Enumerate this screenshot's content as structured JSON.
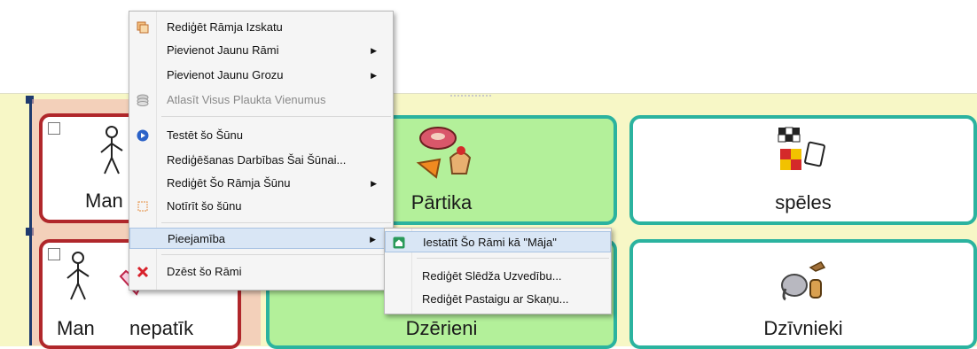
{
  "context_menu": {
    "items": [
      {
        "label": "Rediģēt Rāmja Izskatu",
        "icon": "frame-appearance-icon",
        "disabled": false,
        "submenu": false
      },
      {
        "label": "Pievienot Jaunu Rāmi",
        "icon": "",
        "disabled": false,
        "submenu": true
      },
      {
        "label": "Pievienot Jaunu Grozu",
        "icon": "",
        "disabled": false,
        "submenu": true
      },
      {
        "label": "Atlasīt Visus Plaukta Vienumus",
        "icon": "stack-icon",
        "disabled": true,
        "submenu": false
      },
      {
        "label": "Testēt šo Šūnu",
        "icon": "play-icon",
        "disabled": false,
        "submenu": false
      },
      {
        "label": "Rediģēšanas Darbības Šai Šūnai...",
        "icon": "",
        "disabled": false,
        "submenu": false
      },
      {
        "label": "Rediģēt Šo Rāmja Šūnu",
        "icon": "",
        "disabled": false,
        "submenu": true
      },
      {
        "label": "Notīrīt šo šūnu",
        "icon": "clear-cell-icon",
        "disabled": false,
        "submenu": false
      },
      {
        "label": "Pieejamība",
        "icon": "",
        "disabled": false,
        "submenu": true
      },
      {
        "label": "Dzēst šo Rāmi",
        "icon": "delete-x-icon",
        "disabled": false,
        "submenu": false
      }
    ]
  },
  "submenu": {
    "items": [
      {
        "label": "Iestatīt Šo Rāmi kā \"Māja\"",
        "icon": "home-icon"
      },
      {
        "label": "Rediģēt Slēdža Uzvedību...",
        "icon": ""
      },
      {
        "label": "Rediģēt Pastaigu ar Skaņu...",
        "icon": ""
      }
    ]
  },
  "cells": [
    {
      "label": "Man",
      "style": "red",
      "symbol": "person-like-icon"
    },
    {
      "label": "Pārtika",
      "style": "green",
      "symbol": "food-icon"
    },
    {
      "label": "spēles",
      "style": "white",
      "symbol": "games-icon"
    },
    {
      "label_a": "Man",
      "label_b": "nepatīk",
      "style": "red",
      "symbol": "person-dislike-icon"
    },
    {
      "label": "Dzērieni",
      "style": "green",
      "symbol": "drinks-icon"
    },
    {
      "label": "Dzīvnieki",
      "style": "white",
      "symbol": "animals-icon"
    }
  ],
  "colors": {
    "accent": "#2bb39f",
    "red": "#b0272b",
    "green": "#b3f09a",
    "board": "#f7f7c6"
  }
}
